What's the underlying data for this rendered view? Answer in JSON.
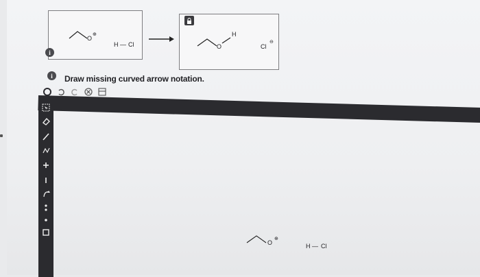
{
  "instruction": "Draw missing curved arrow notation.",
  "info_glyph": "i",
  "reactant_panel": {
    "oxygen_label": "O",
    "oxygen_charge": "⊕",
    "hcl_h": "H",
    "hcl_bond": "—",
    "hcl_cl": "Cl"
  },
  "product_panel": {
    "h_label": "H",
    "oxygen_label": "O",
    "chloride_label": "Cl",
    "chloride_charge": "⊖"
  },
  "canvas_molecules": {
    "oxygen_label": "O",
    "oxygen_charge": "⊕",
    "hcl_h": "H",
    "hcl_bond": "—",
    "hcl_cl": "Cl"
  },
  "toolbar": {
    "icons": [
      "cycle-icon",
      "undo-icon",
      "redo-icon",
      "clear-icon",
      "templates-icon"
    ]
  },
  "sidebar": {
    "icons": [
      "select-icon",
      "eraser-icon",
      "bond-icon",
      "chain-icon",
      "plus-charge-icon",
      "minus-charge-icon",
      "curved-arrow-icon",
      "lone-pair-icon",
      "radical-icon",
      "box-icon"
    ]
  },
  "colors": {
    "toolbar_dark": "#2b2b2f",
    "panel_border": "#7d7d80",
    "text": "#222226"
  }
}
